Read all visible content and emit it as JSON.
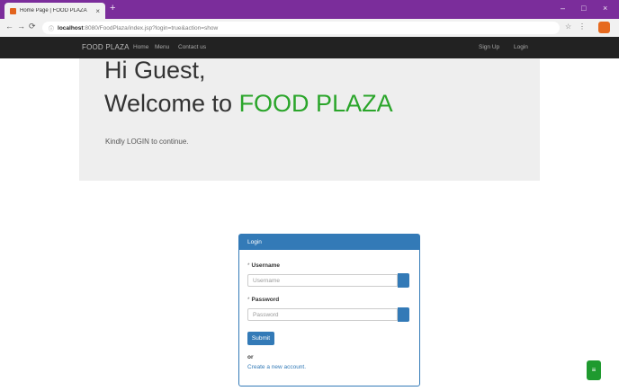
{
  "browser": {
    "tab_title": "Home Page | FOOD PLAZA",
    "tab_close": "×",
    "new_tab": "+",
    "window_controls": [
      "–",
      "□",
      "×"
    ],
    "nav": {
      "back": "←",
      "forward": "→",
      "reload": "⟳"
    },
    "url_host": "localhost",
    "url_path": ":8080/FoodPlaza/index.jsp?login=true&action=show",
    "toolbar_icons": [
      "☆",
      "⋮"
    ]
  },
  "navbar": {
    "brand": "FOOD PLAZA",
    "links": [
      "Home",
      "Menu",
      "Contact us"
    ],
    "right_links": [
      "Sign Up",
      "Login"
    ]
  },
  "jumbotron": {
    "greeting": "Hi Guest,",
    "welcome_prefix": "Welcome to ",
    "welcome_brand": "FOOD PLAZA",
    "prompt": "Kindly LOGIN to continue."
  },
  "login": {
    "heading": "Login",
    "username_label": "Username",
    "username_placeholder": "Username",
    "password_label": "Password",
    "password_placeholder": "Password",
    "required_marker": "*",
    "submit": "Submit",
    "or_text": "or",
    "create_link": "Create a new account."
  },
  "fab": {
    "label": "≡"
  },
  "colors": {
    "accent": "#337ab7",
    "brand_green": "#2aa52a",
    "navbar_bg": "#222222",
    "chrome_purple": "#7b2d9b",
    "fab_green": "#1f9a2f"
  }
}
